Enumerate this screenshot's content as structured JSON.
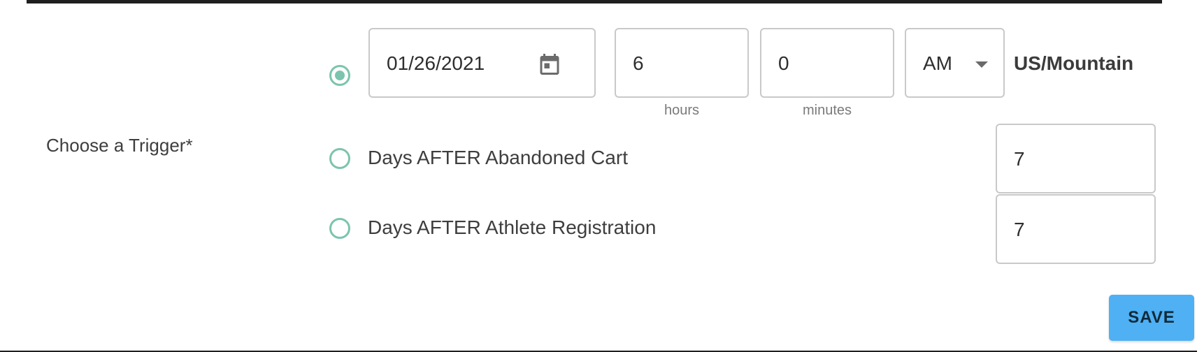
{
  "form": {
    "trigger_label": "Choose a Trigger*",
    "timezone": "US/Mountain",
    "save_label": "SAVE",
    "accent_color": "#7cc4ad",
    "save_color": "#4fb0f3"
  },
  "schedule_option": {
    "selected": true,
    "date_value": "01/26/2021",
    "date_icon": "calendar-icon",
    "hours_value": "6",
    "hours_helper": "hours",
    "minutes_value": "0",
    "minutes_helper": "minutes",
    "ampm_value": "AM",
    "ampm_icon": "chevron-down-icon"
  },
  "options": [
    {
      "label": "Days AFTER Abandoned Cart",
      "value": "7",
      "selected": false
    },
    {
      "label": "Days AFTER Athlete Registration",
      "value": "7",
      "selected": false
    }
  ]
}
